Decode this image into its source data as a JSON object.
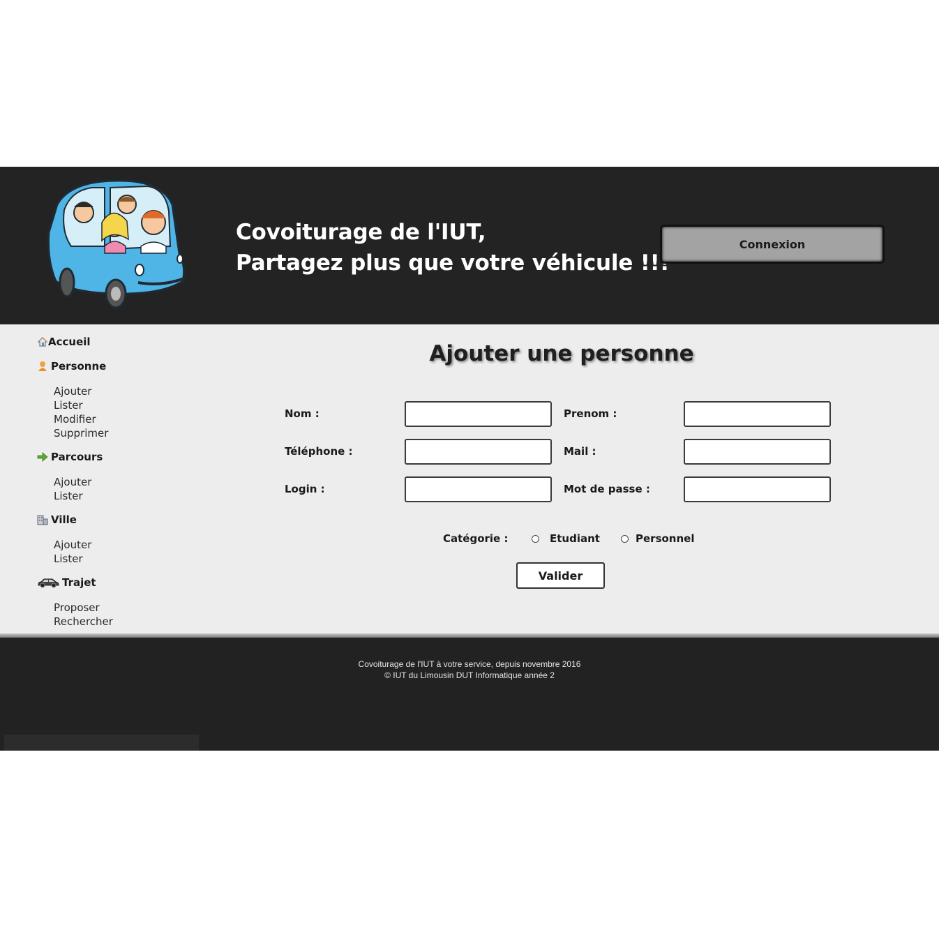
{
  "header": {
    "title_line1": "Covoiturage de l'IUT,",
    "title_line2": "Partagez plus que votre véhicule !!!",
    "connexion_label": "Connexion",
    "background_color": "#232323"
  },
  "sidebar": {
    "accueil": {
      "label": "Accueil",
      "icon": "home-icon"
    },
    "personne": {
      "label": "Personne",
      "icon": "person-icon",
      "items": [
        "Ajouter",
        "Lister",
        "Modifier",
        "Supprimer"
      ]
    },
    "parcours": {
      "label": "Parcours",
      "icon": "arrow-right-icon",
      "items": [
        "Ajouter",
        "Lister"
      ]
    },
    "ville": {
      "label": "Ville",
      "icon": "building-icon",
      "items": [
        "Ajouter",
        "Lister"
      ]
    },
    "trajet": {
      "label": "Trajet",
      "icon": "car-icon",
      "items": [
        "Proposer",
        "Rechercher"
      ]
    }
  },
  "form": {
    "heading": "Ajouter une personne",
    "nom_label": "Nom :",
    "prenom_label": "Prenom :",
    "telephone_label": "Téléphone :",
    "mail_label": "Mail :",
    "login_label": "Login :",
    "password_label": "Mot de passe :",
    "categorie_label": "Catégorie :",
    "option_etudiant": "Etudiant",
    "option_personnel": "Personnel",
    "submit_label": "Valider",
    "nom_value": "",
    "prenom_value": "",
    "telephone_value": "",
    "mail_value": "",
    "login_value": "",
    "password_value": ""
  },
  "footer": {
    "line1": "Covoiturage de l'IUT à votre service, depuis novembre 2016",
    "line2": "© IUT du Limousin DUT Informatique année 2"
  }
}
